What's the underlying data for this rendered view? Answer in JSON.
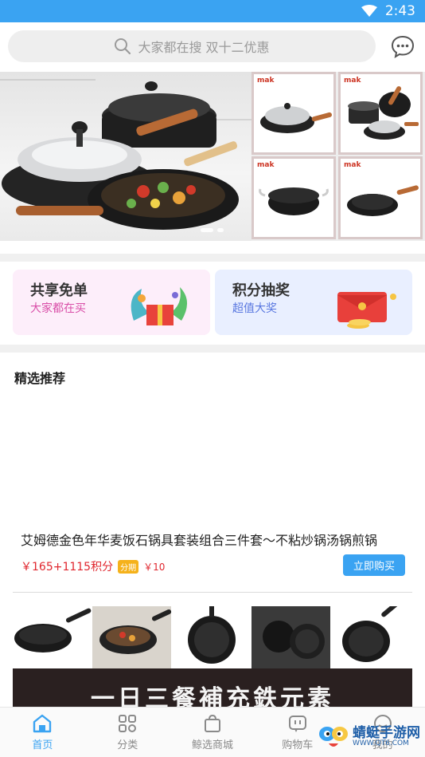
{
  "status_bar": {
    "time": "2:43"
  },
  "search": {
    "placeholder": "大家都在搜 双十二优惠"
  },
  "banner": {
    "brand": "mak",
    "slide_count": 2,
    "active_slide": 1
  },
  "promos": [
    {
      "title": "共享免单",
      "subtitle": "大家都在买",
      "bg": "#fdeefa",
      "subtitle_color": "#d94fa8"
    },
    {
      "title": "积分抽奖",
      "subtitle": "超值大奖",
      "bg": "#e9efff",
      "subtitle_color": "#5a78e0"
    }
  ],
  "section": {
    "title": "精选推荐"
  },
  "product": {
    "title": "艾姆德金色年华麦饭石锅具套装组合三件套～不粘炒锅汤锅煎锅",
    "price": "￥165+1115积分",
    "installment_badge": "分期",
    "installment_price": "￥10",
    "buy_label": "立即购买"
  },
  "dark_banner_text": "一日三餐補充鉄元素",
  "tabs": [
    {
      "label": "首页",
      "icon": "home-icon",
      "active": true
    },
    {
      "label": "分类",
      "icon": "category-icon",
      "active": false
    },
    {
      "label": "鲸选商城",
      "icon": "shopping-bag-icon",
      "active": false
    },
    {
      "label": "购物车",
      "icon": "cart-icon",
      "active": false
    },
    {
      "label": "我的",
      "icon": "profile-icon",
      "active": false
    }
  ],
  "watermark": {
    "name": "蜻蜓手游网",
    "url": "WWW.QT6.COM"
  },
  "colors": {
    "accent": "#3aa3f2",
    "price": "#e0262e"
  }
}
